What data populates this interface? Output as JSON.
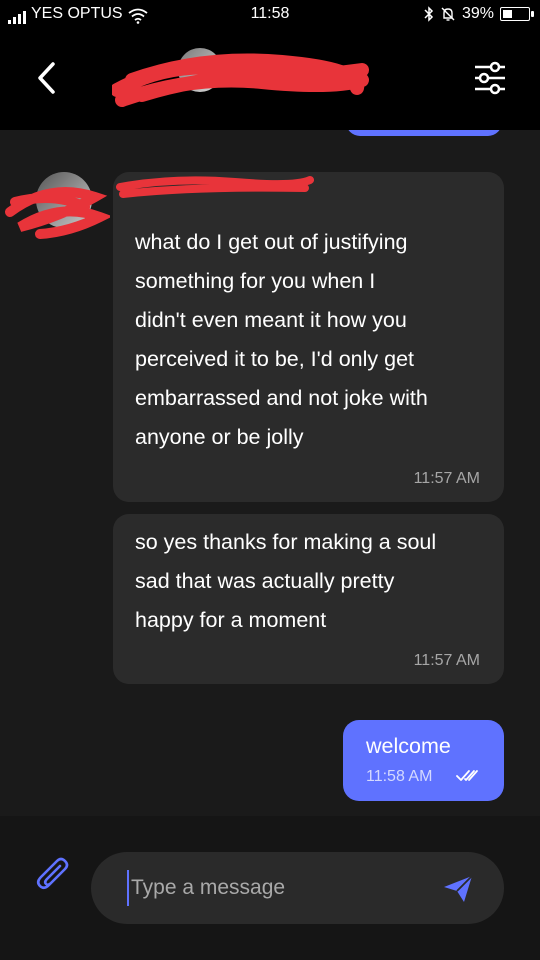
{
  "status_bar": {
    "carrier": "YES OPTUS",
    "time": "11:58",
    "battery": "39%",
    "battery_level": 0.39,
    "icons": [
      "signal-icon",
      "wifi-icon",
      "bluetooth-icon",
      "mute-bell-icon",
      "battery-icon"
    ]
  },
  "header": {
    "back_icon": "chevron-left-icon",
    "settings_icon": "sliders-icon",
    "title_redacted": true
  },
  "messages": [
    {
      "direction": "incoming",
      "sender_redacted": true,
      "text_lines": [
        "what do I get out of justifying",
        "something for you when I",
        "didn't even meant it how you",
        "perceived it to be, I'd only get",
        "embarrassed and not joke with",
        "anyone or be jolly"
      ],
      "time": "11:57 AM"
    },
    {
      "direction": "incoming",
      "text_lines": [
        "so yes thanks for making a soul",
        "sad that was actually pretty",
        "happy for a moment"
      ],
      "time": "11:57 AM"
    },
    {
      "direction": "outgoing",
      "text": "welcome",
      "time": "11:58 AM",
      "status_icon": "double-check-icon"
    }
  ],
  "composer": {
    "placeholder": "Type a message",
    "value": "",
    "attach_icon": "paperclip-icon",
    "send_icon": "send-icon"
  },
  "colors": {
    "accent": "#5f72ff",
    "bubble_in": "#2b2b2b",
    "chat_bg": "#1a1a1a",
    "redaction": "#e8343a"
  }
}
